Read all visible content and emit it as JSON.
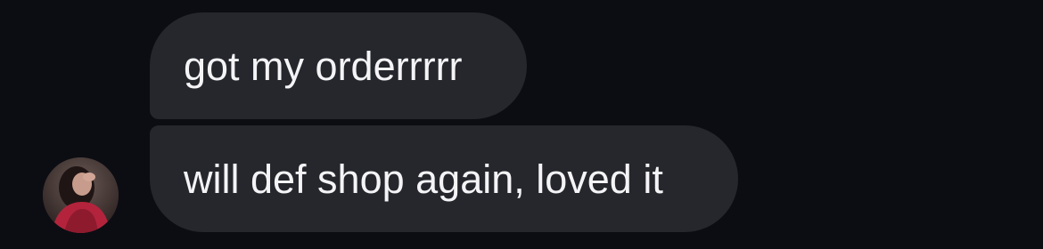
{
  "conversation": {
    "messages": [
      {
        "text": "got my orderrrrr"
      },
      {
        "text": "will def shop again, loved it"
      }
    ],
    "sender": {
      "avatar_icon": "user-photo-avatar"
    }
  },
  "colors": {
    "background": "#0c0d13",
    "bubble": "#25272d",
    "text": "#f4f4f6"
  }
}
